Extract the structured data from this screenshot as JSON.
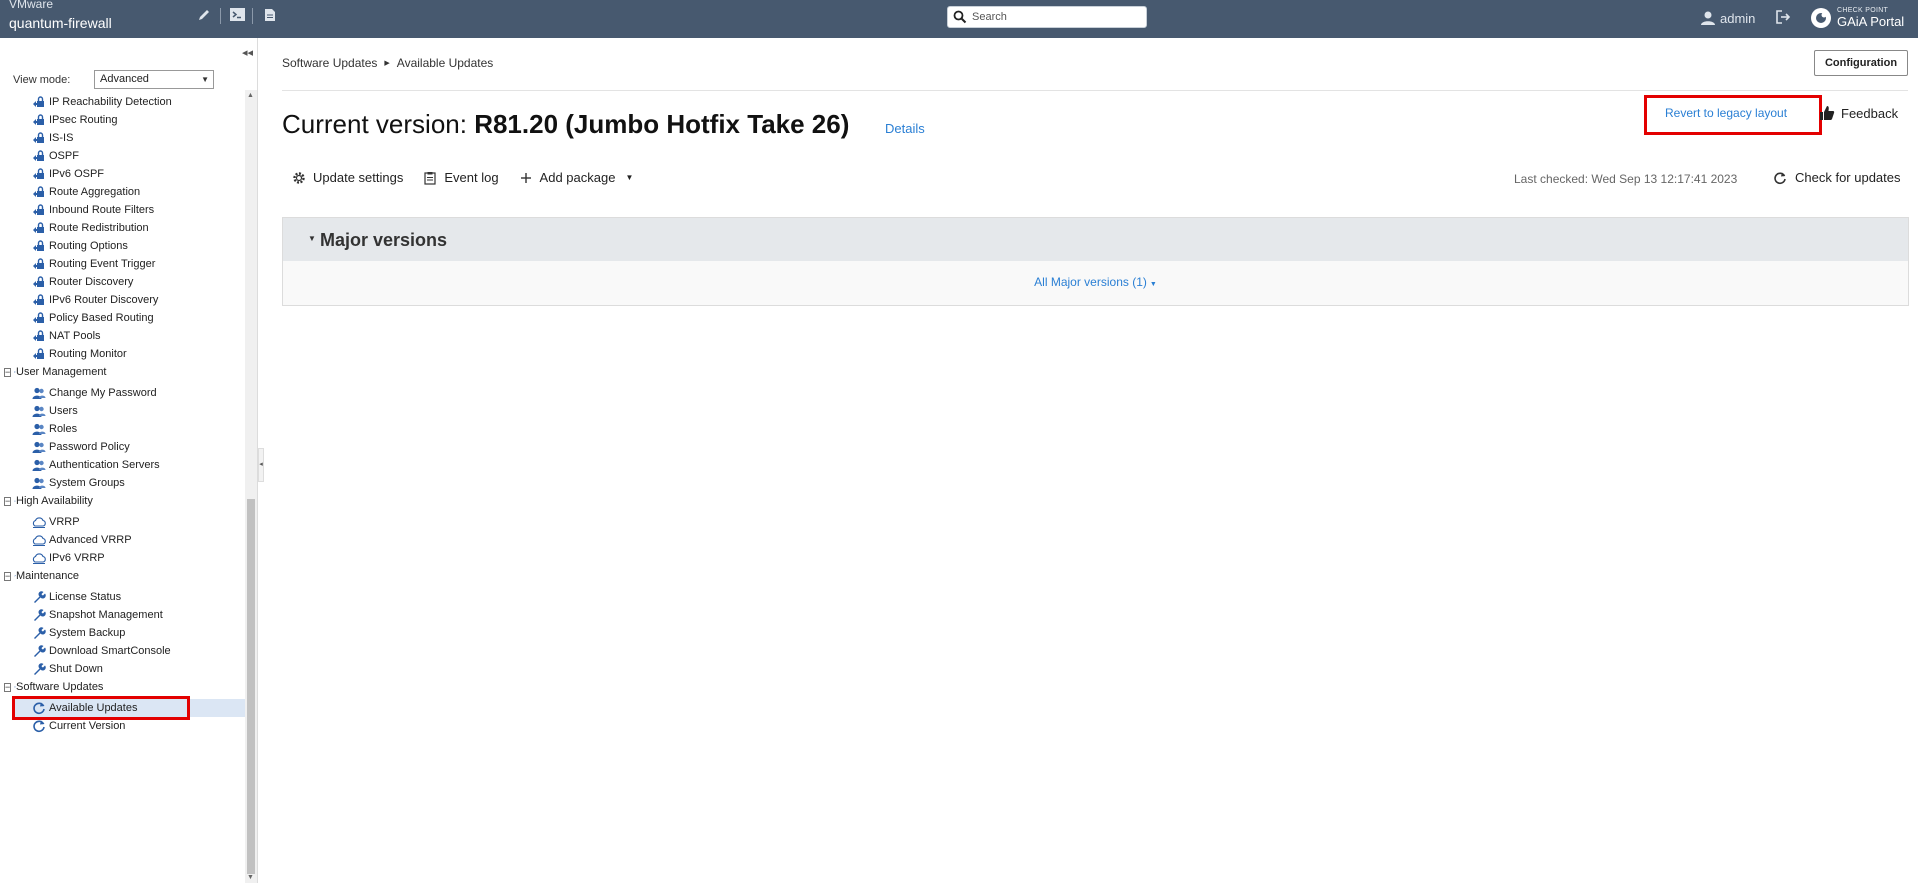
{
  "topbar": {
    "vm_label": "VMware",
    "hostname": "quantum-firewall",
    "search_placeholder": "Search",
    "user": "admin",
    "brand_small": "CHECK POINT",
    "brand_portal": "GAiA Portal"
  },
  "sidebar": {
    "view_mode_label": "View mode:",
    "view_mode_value": "Advanced",
    "items": [
      {
        "label": "IP Reachability Detection",
        "icon": "routing-icon",
        "group": false
      },
      {
        "label": "IPsec Routing",
        "icon": "routing-icon",
        "group": false
      },
      {
        "label": "IS-IS",
        "icon": "routing-icon",
        "group": false
      },
      {
        "label": "OSPF",
        "icon": "routing-icon",
        "group": false
      },
      {
        "label": "IPv6 OSPF",
        "icon": "routing-icon",
        "group": false
      },
      {
        "label": "Route Aggregation",
        "icon": "routing-icon",
        "group": false
      },
      {
        "label": "Inbound Route Filters",
        "icon": "routing-icon",
        "group": false
      },
      {
        "label": "Route Redistribution",
        "icon": "routing-icon",
        "group": false
      },
      {
        "label": "Routing Options",
        "icon": "routing-icon",
        "group": false
      },
      {
        "label": "Routing Event Trigger",
        "icon": "routing-icon",
        "group": false
      },
      {
        "label": "Router Discovery",
        "icon": "routing-icon",
        "group": false
      },
      {
        "label": "IPv6 Router Discovery",
        "icon": "routing-icon",
        "group": false
      },
      {
        "label": "Policy Based Routing",
        "icon": "routing-icon",
        "group": false
      },
      {
        "label": "NAT Pools",
        "icon": "routing-icon",
        "group": false
      },
      {
        "label": "Routing Monitor",
        "icon": "routing-icon",
        "group": false
      },
      {
        "label": "User Management",
        "icon": "users-icon",
        "group": true
      },
      {
        "label": "Change My Password",
        "icon": "users-icon",
        "group": false
      },
      {
        "label": "Users",
        "icon": "users-icon",
        "group": false
      },
      {
        "label": "Roles",
        "icon": "users-icon",
        "group": false
      },
      {
        "label": "Password Policy",
        "icon": "users-icon",
        "group": false
      },
      {
        "label": "Authentication Servers",
        "icon": "users-icon",
        "group": false
      },
      {
        "label": "System Groups",
        "icon": "users-icon",
        "group": false
      },
      {
        "label": "High Availability",
        "icon": "cloud-icon",
        "group": true
      },
      {
        "label": "VRRP",
        "icon": "cloud-icon",
        "group": false
      },
      {
        "label": "Advanced VRRP",
        "icon": "cloud-icon",
        "group": false
      },
      {
        "label": "IPv6 VRRP",
        "icon": "cloud-icon",
        "group": false
      },
      {
        "label": "Maintenance",
        "icon": "wrench-icon",
        "group": true
      },
      {
        "label": "License Status",
        "icon": "wrench-icon",
        "group": false
      },
      {
        "label": "Snapshot Management",
        "icon": "wrench-icon",
        "group": false
      },
      {
        "label": "System Backup",
        "icon": "wrench-icon",
        "group": false
      },
      {
        "label": "Download SmartConsole",
        "icon": "wrench-icon",
        "group": false
      },
      {
        "label": "Shut Down",
        "icon": "wrench-icon",
        "group": false
      },
      {
        "label": "Software Updates",
        "icon": "refresh-icon",
        "group": true
      },
      {
        "label": "Available Updates",
        "icon": "refresh-icon",
        "group": false,
        "selected": true
      },
      {
        "label": "Current Version",
        "icon": "refresh-icon",
        "group": false
      }
    ]
  },
  "main": {
    "breadcrumb": [
      "Software Updates",
      "Available Updates"
    ],
    "config_button": "Configuration",
    "title_prefix": "Current version: ",
    "title_version": "R81.20 (Jumbo Hotfix Take 26)",
    "details_link": "Details",
    "revert_link": "Revert to legacy layout",
    "feedback": "Feedback",
    "toolbar": {
      "update_settings": "Update settings",
      "event_log": "Event log",
      "add_package": "Add package"
    },
    "last_checked": "Last checked: Wed Sep 13 12:17:41 2023",
    "check_updates": "Check for updates",
    "panel_title": "Major versions",
    "panel_link": "All Major versions (1)"
  },
  "colors": {
    "topbar": "#47596f",
    "link": "#2a7fd4",
    "highlight_box": "#e30000",
    "icon_blue": "#2b5fa8"
  }
}
